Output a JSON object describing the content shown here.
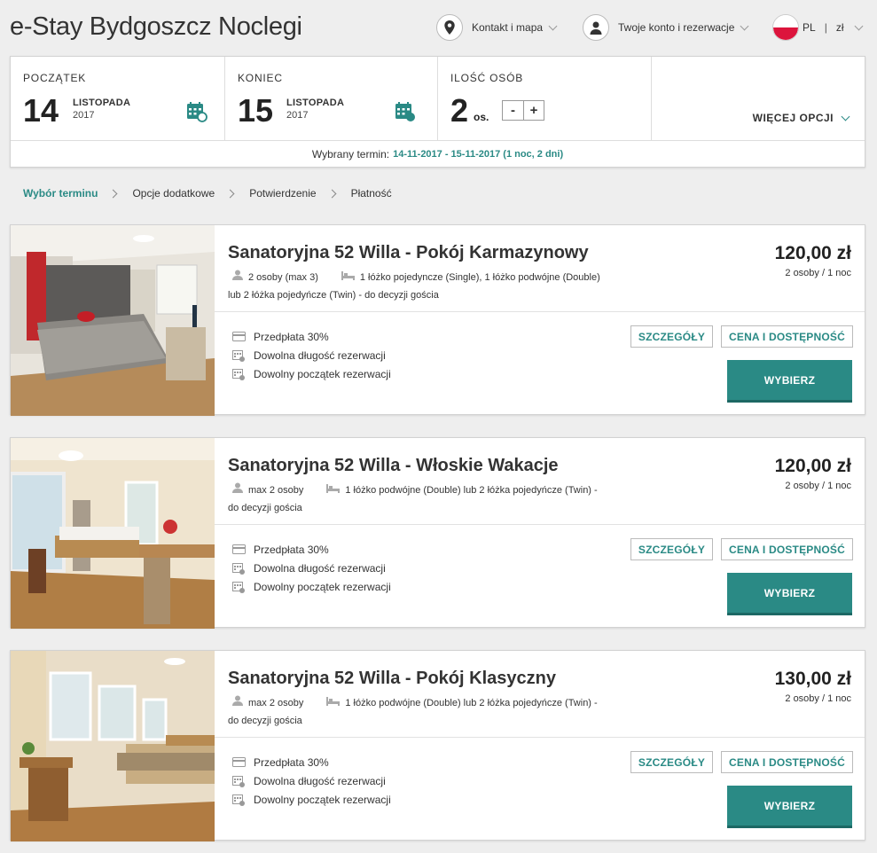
{
  "header": {
    "title": "e-Stay Bydgoszcz Noclegi",
    "contact_label": "Kontakt i mapa",
    "account_label": "Twoje konto i rezerwacje",
    "language": "PL",
    "currency": "zł"
  },
  "search": {
    "start_label": "POCZĄTEK",
    "start_day": "14",
    "start_month": "LISTOPADA",
    "start_year": "2017",
    "end_label": "KONIEC",
    "end_day": "15",
    "end_month": "LISTOPADA",
    "end_year": "2017",
    "persons_label": "ILOŚĆ OSÓB",
    "persons_count": "2",
    "persons_unit": "os.",
    "minus": "-",
    "plus": "+",
    "more_options": "WIĘCEJ OPCJI",
    "term_prefix": "Wybrany termin:",
    "term_value": "14-11-2017 - 15-11-2017 (1 noc, 2 dni)"
  },
  "breadcrumb": {
    "steps": [
      "Wybór terminu",
      "Opcje dodatkowe",
      "Potwierdzenie",
      "Płatność"
    ]
  },
  "rooms": [
    {
      "name": "Sanatoryjna 52 Willa - Pokój Karmazynowy",
      "occupancy": "2 osoby (max 3)",
      "beds_line1": "1 łóżko pojedyncze (Single), 1 łóżko podwójne (Double)",
      "beds_line2": "lub 2 łóżka pojedyńcze (Twin) - do decyzji gościa",
      "price": "120,00 zł",
      "price_sub": "2 osoby / 1 noc",
      "features": [
        "Przedpłata 30%",
        "Dowolna długość rezerwacji",
        "Dowolny początek rezerwacji"
      ],
      "details_btn": "SZCZEGÓŁY",
      "availability_btn": "CENA I DOSTĘPNOŚĆ",
      "select_btn": "WYBIERZ"
    },
    {
      "name": "Sanatoryjna 52 Willa - Włoskie Wakacje",
      "occupancy": "max 2 osoby",
      "beds_line1": "1 łóżko podwójne (Double) lub 2 łóżka pojedyńcze (Twin) -",
      "beds_line2": "do decyzji gościa",
      "price": "120,00 zł",
      "price_sub": "2 osoby / 1 noc",
      "features": [
        "Przedpłata 30%",
        "Dowolna długość rezerwacji",
        "Dowolny początek rezerwacji"
      ],
      "details_btn": "SZCZEGÓŁY",
      "availability_btn": "CENA I DOSTĘPNOŚĆ",
      "select_btn": "WYBIERZ"
    },
    {
      "name": "Sanatoryjna 52 Willa - Pokój Klasyczny",
      "occupancy": "max 2 osoby",
      "beds_line1": "1 łóżko podwójne (Double) lub 2 łóżka pojedyńcze (Twin) -",
      "beds_line2": "do decyzji gościa",
      "price": "130,00 zł",
      "price_sub": "2 osoby / 1 noc",
      "features": [
        "Przedpłata 30%",
        "Dowolna długość rezerwacji",
        "Dowolny początek rezerwacji"
      ],
      "details_btn": "SZCZEGÓŁY",
      "availability_btn": "CENA I DOSTĘPNOŚĆ",
      "select_btn": "WYBIERZ"
    }
  ],
  "colors": {
    "accent": "#2a8a85",
    "background": "#eeeeee",
    "flag_red": "#dc143c"
  },
  "icons": {
    "contact": "map-pin-icon",
    "account": "user-icon",
    "calendar": "calendar-icon",
    "person": "person-icon",
    "bed": "bed-icon",
    "card": "credit-card-icon"
  }
}
